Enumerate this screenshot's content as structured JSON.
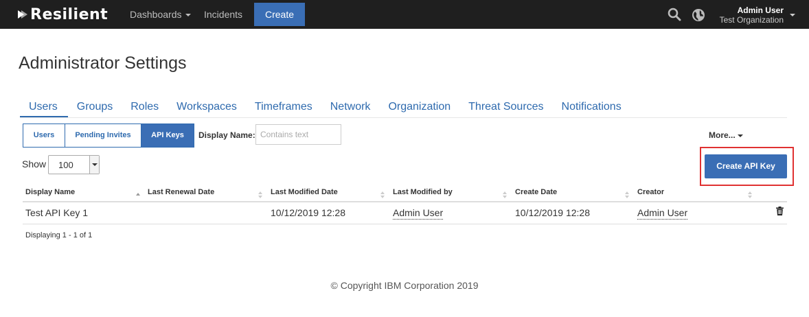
{
  "nav": {
    "brand": "Resilient",
    "dashboards": "Dashboards",
    "incidents": "Incidents",
    "create": "Create",
    "user_name": "Admin User",
    "user_org": "Test Organization"
  },
  "page": {
    "title": "Administrator Settings"
  },
  "tabs": [
    {
      "label": "Users",
      "active": true
    },
    {
      "label": "Groups"
    },
    {
      "label": "Roles"
    },
    {
      "label": "Workspaces"
    },
    {
      "label": "Timeframes"
    },
    {
      "label": "Network"
    },
    {
      "label": "Organization"
    },
    {
      "label": "Threat Sources"
    },
    {
      "label": "Notifications"
    }
  ],
  "subtabs": [
    {
      "label": "Users"
    },
    {
      "label": "Pending Invites"
    },
    {
      "label": "API Keys",
      "active": true
    }
  ],
  "filter": {
    "label": "Display Name:",
    "placeholder": "Contains text"
  },
  "more": "More...",
  "create_api_key": "Create API Key",
  "show": {
    "label": "Show",
    "value": "100"
  },
  "table": {
    "columns": [
      "Display Name",
      "Last Renewal Date",
      "Last Modified Date",
      "Last Modified by",
      "Create Date",
      "Creator"
    ],
    "rows": [
      {
        "display_name": "Test API Key 1",
        "last_renewal_date": "",
        "last_modified_date": "10/12/2019 12:28",
        "last_modified_by": "Admin User",
        "create_date": "10/12/2019 12:28",
        "creator": "Admin User"
      }
    ],
    "footer": "Displaying 1 - 1 of 1"
  },
  "copyright": "© Copyright IBM Corporation 2019",
  "colors": {
    "accent": "#3a6eb5",
    "topbar": "#1f1f1f",
    "highlight": "#e03131"
  },
  "icons": [
    "resilient-logo-icon",
    "search-icon",
    "globe-icon",
    "sort-icon",
    "trash-icon"
  ]
}
